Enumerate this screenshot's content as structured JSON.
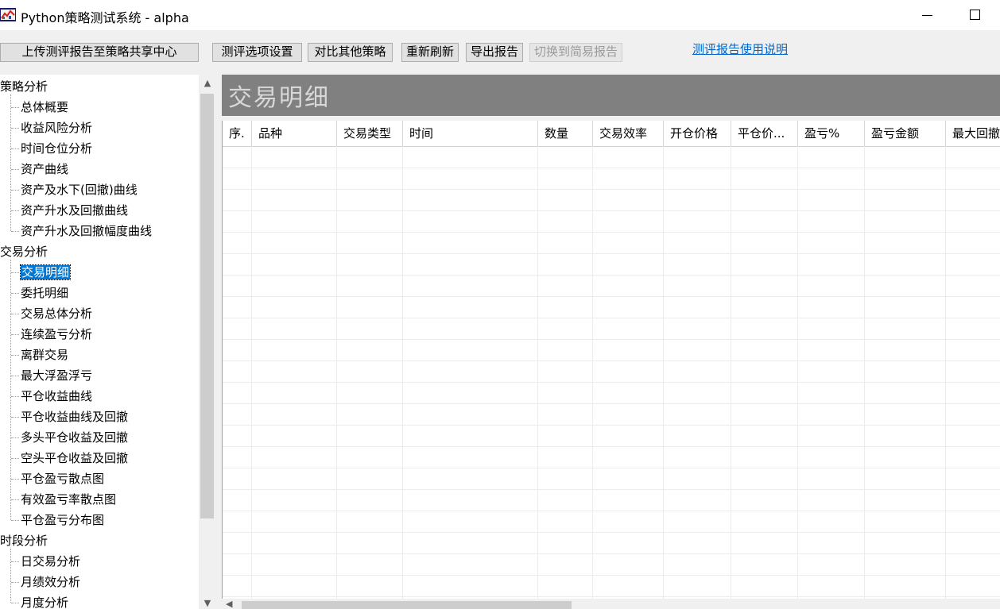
{
  "window": {
    "title": "Python策略测试系统 - alpha"
  },
  "toolbar": {
    "upload": "上传测评报告至策略共享中心",
    "options": "测评选项设置",
    "compare": "对比其他策略",
    "refresh": "重新刷新",
    "export": "导出报告",
    "simple": "切换到简易报告",
    "help": "测评报告使用说明"
  },
  "tree": {
    "groups": [
      {
        "label": "策略分析",
        "children": [
          "总体概要",
          "收益风险分析",
          "时间仓位分析",
          "资产曲线",
          "资产及水下(回撤)曲线",
          "资产升水及回撤曲线",
          "资产升水及回撤幅度曲线"
        ]
      },
      {
        "label": "交易分析",
        "children": [
          "交易明细",
          "委托明细",
          "交易总体分析",
          "连续盈亏分析",
          "离群交易",
          "最大浮盈浮亏",
          "平仓收益曲线",
          "平仓收益曲线及回撤",
          "多头平仓收益及回撤",
          "空头平仓收益及回撤",
          "平仓盈亏散点图",
          "有效盈亏率散点图",
          "平仓盈亏分布图"
        ]
      },
      {
        "label": "时段分析",
        "children": [
          "日交易分析",
          "月绩效分析",
          "月度分析"
        ]
      }
    ],
    "selected": "交易明细"
  },
  "main": {
    "title": "交易明细",
    "columns": [
      "序.",
      "品种",
      "交易类型",
      "时间",
      "数量",
      "交易效率",
      "开仓价格",
      "平仓价...",
      "盈亏%",
      "盈亏金额",
      "最大回撤"
    ]
  }
}
